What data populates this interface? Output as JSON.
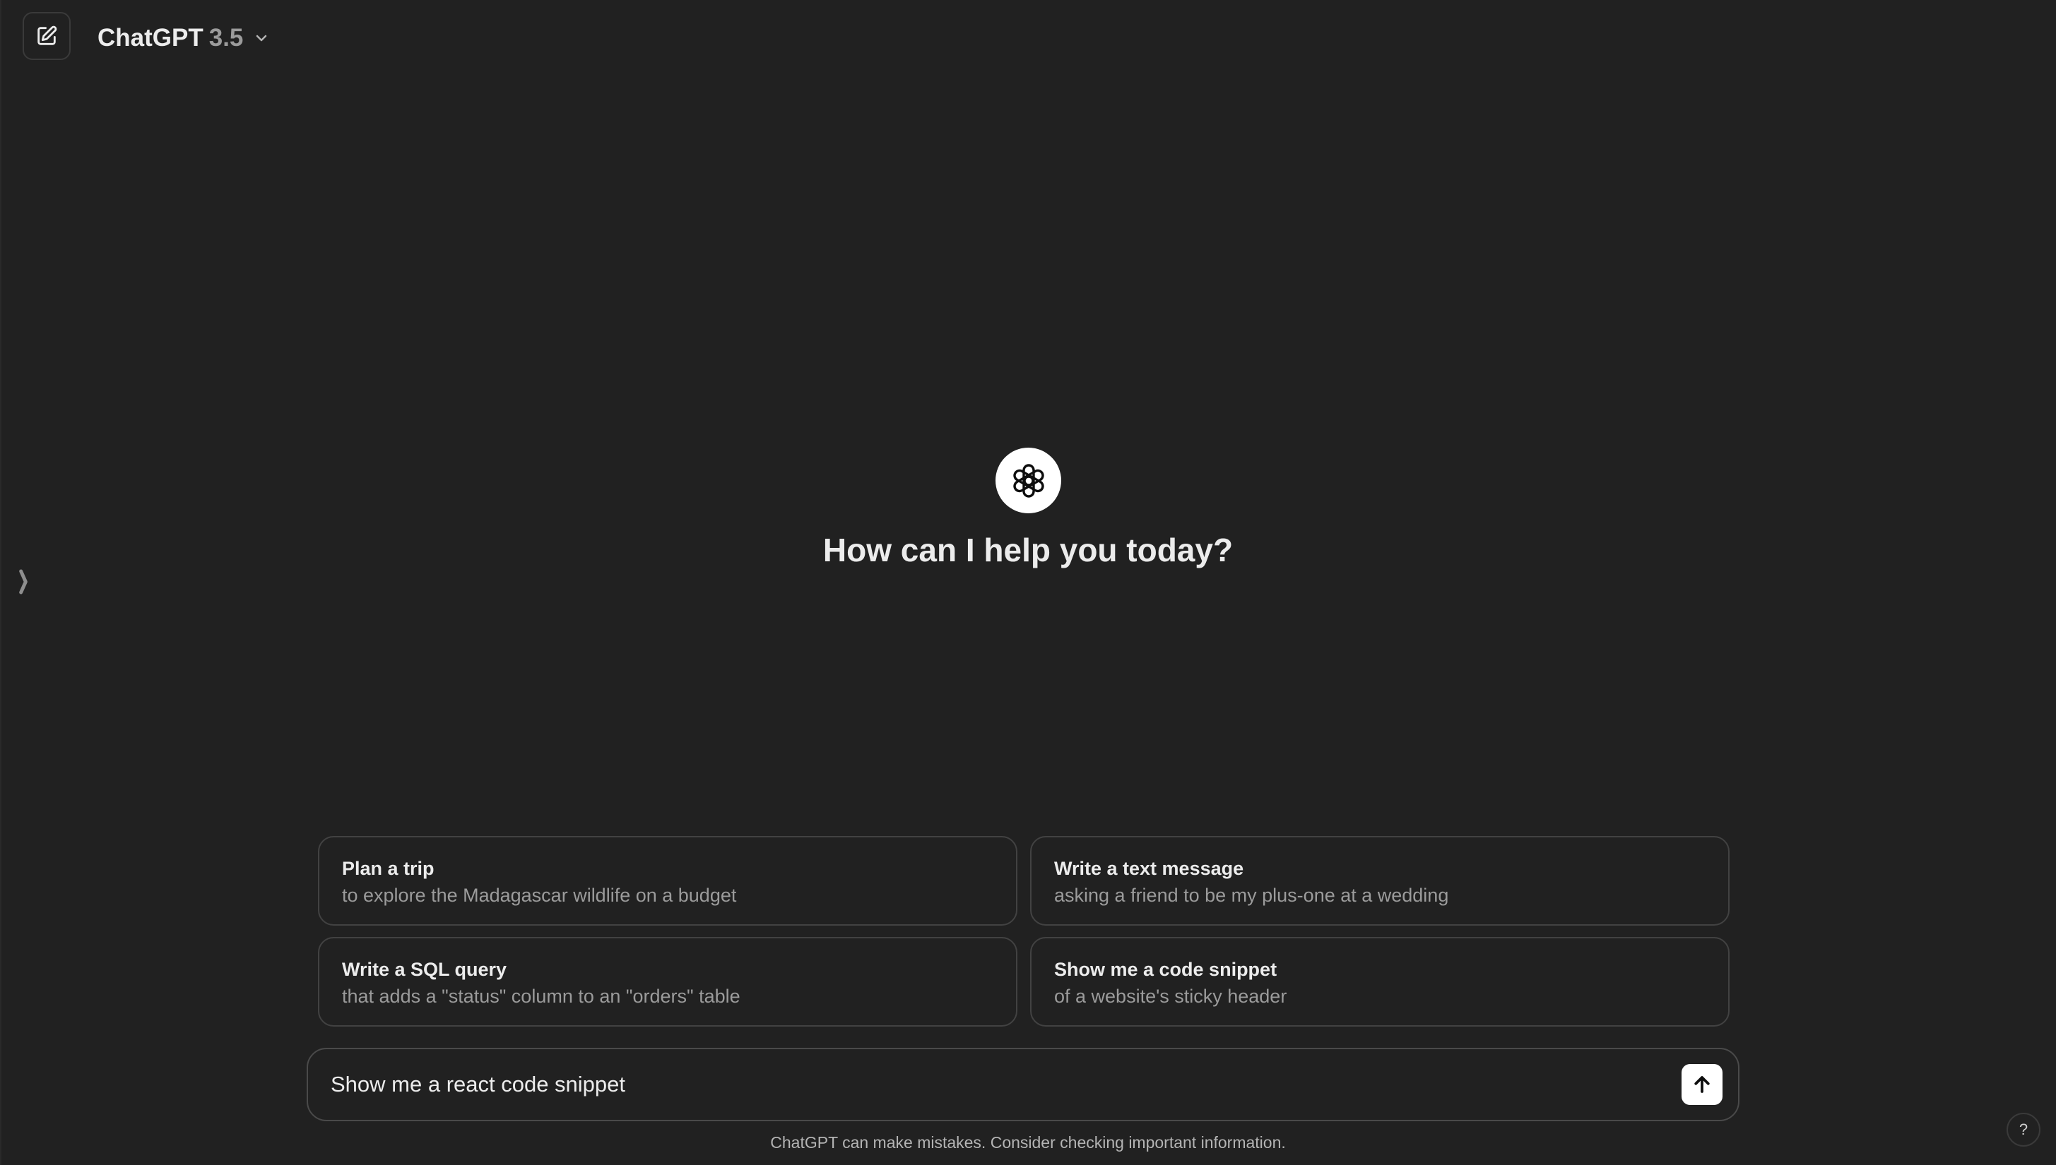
{
  "header": {
    "model_name": "ChatGPT",
    "model_version": "3.5",
    "new_chat_icon": "edit-icon",
    "dropdown_icon": "chevron-down-icon"
  },
  "sidebar": {
    "toggle_icon": "chevron-right-icon"
  },
  "hero": {
    "logo_icon": "openai-logo-icon",
    "title": "How can I help you today?"
  },
  "suggestions": [
    {
      "title": "Plan a trip",
      "subtitle": "to explore the Madagascar wildlife on a budget"
    },
    {
      "title": "Write a text message",
      "subtitle": "asking a friend to be my plus-one at a wedding"
    },
    {
      "title": "Write a SQL query",
      "subtitle": "that adds a \"status\" column to an \"orders\" table"
    },
    {
      "title": "Show me a code snippet",
      "subtitle": "of a website's sticky header"
    }
  ],
  "composer": {
    "value": "Show me a react code snippet",
    "send_icon": "arrow-up-icon"
  },
  "footer": {
    "disclaimer": "ChatGPT can make mistakes. Consider checking important information.",
    "help_label": "?"
  },
  "colors": {
    "background": "#212121",
    "text": "#ececec",
    "muted_text": "#9b9b9b",
    "border": "#424242",
    "accent": "#ffffff"
  }
}
